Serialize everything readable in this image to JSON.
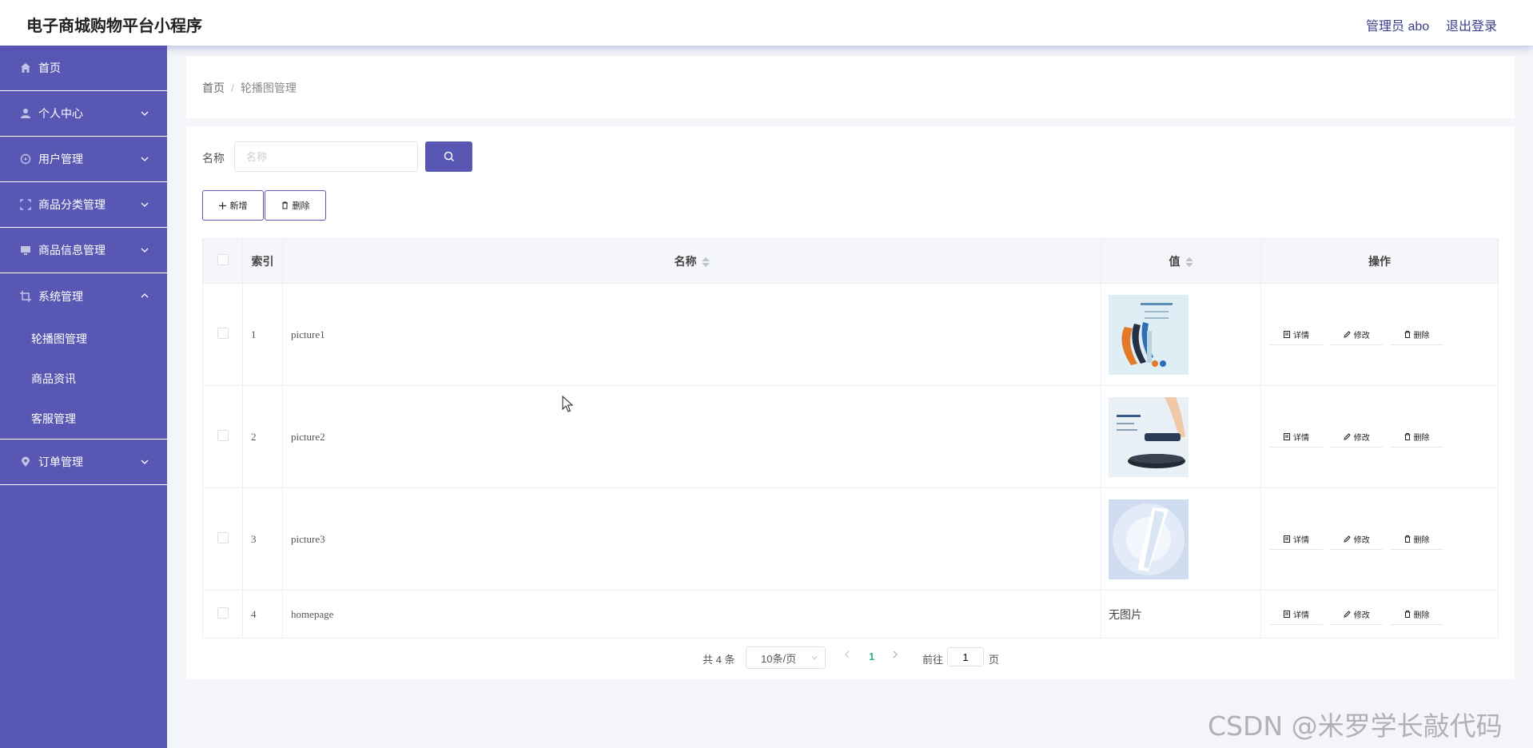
{
  "header": {
    "title": "电子商城购物平台小程序",
    "user": "管理员 abo",
    "logout": "退出登录"
  },
  "sidebar": {
    "items": [
      {
        "label": "首页",
        "icon": "home-icon"
      },
      {
        "label": "个人中心",
        "icon": "user-icon"
      },
      {
        "label": "用户管理",
        "icon": "users-icon"
      },
      {
        "label": "商品分类管理",
        "icon": "category-icon"
      },
      {
        "label": "商品信息管理",
        "icon": "monitor-icon"
      },
      {
        "label": "系统管理",
        "icon": "crop-icon"
      },
      {
        "label": "订单管理",
        "icon": "location-icon"
      }
    ],
    "sub": [
      "轮播图管理",
      "商品资讯",
      "客服管理"
    ]
  },
  "breadcrumb": {
    "home": "首页",
    "sep": "/",
    "current": "轮播图管理"
  },
  "search": {
    "label": "名称",
    "placeholder": "名称",
    "value": ""
  },
  "toolbar": {
    "add": "新增",
    "delete": "删除"
  },
  "table": {
    "headers": {
      "index": "索引",
      "name": "名称",
      "value": "值",
      "ops": "操作"
    },
    "rows": [
      {
        "index": "1",
        "name": "picture1",
        "value": "",
        "image": "banner-watch"
      },
      {
        "index": "2",
        "name": "picture2",
        "value": "",
        "image": "banner-pad"
      },
      {
        "index": "3",
        "name": "picture3",
        "value": "",
        "image": "banner-light"
      },
      {
        "index": "4",
        "name": "homepage",
        "value": "无图片",
        "image": ""
      }
    ],
    "ops": {
      "detail": "详情",
      "edit": "修改",
      "delete": "删除"
    }
  },
  "pager": {
    "total": "共 4 条",
    "size": "10条/页",
    "page": "1",
    "goto": "前往",
    "goto_value": "1",
    "suffix": "页"
  },
  "watermark": "CSDN @米罗学长敲代码",
  "colors": {
    "primary": "#5857b4",
    "active_page": "#30b08f"
  }
}
